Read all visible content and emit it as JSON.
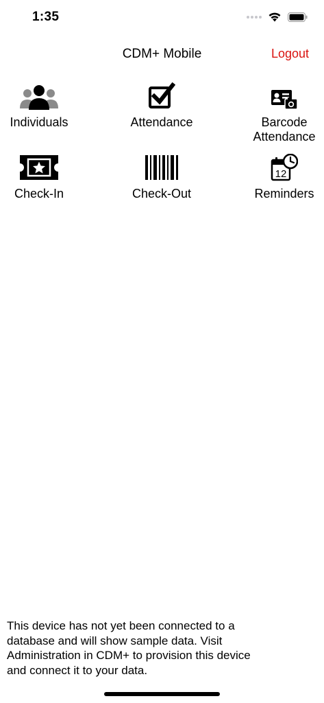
{
  "status_bar": {
    "time": "1:35"
  },
  "nav": {
    "title": "CDM+ Mobile",
    "logout_label": "Logout"
  },
  "menu": {
    "individuals": "Individuals",
    "attendance": "Attendance",
    "barcode_attendance": "Barcode\nAttendance",
    "check_in": "Check-In",
    "check_out": "Check-Out",
    "reminders": "Reminders",
    "reminders_calendar_day": "12"
  },
  "footer": {
    "message": "This device has not yet been connected to a database and will show sample data. Visit Administration in CDM+ to provision this device and connect it to your data."
  },
  "colors": {
    "accent": "#d9120f",
    "text": "#000000",
    "background": "#ffffff"
  }
}
